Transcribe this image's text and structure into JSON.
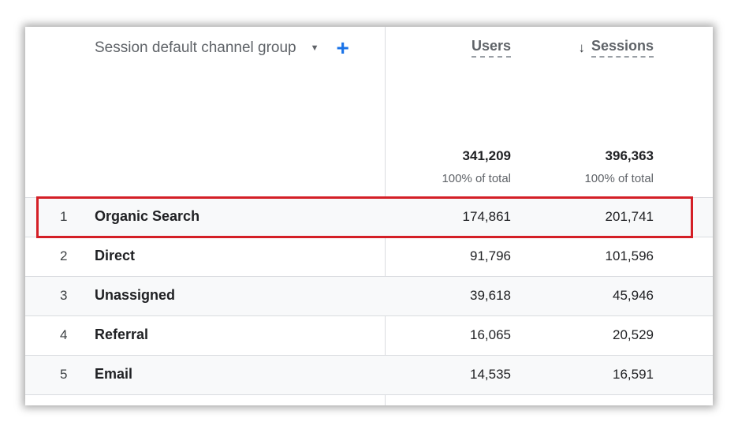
{
  "header": {
    "dimension_label": "Session default channel group",
    "dimension_dropdown_icon": "caret-down-icon",
    "add_dimension_icon": "plus-icon",
    "columns": [
      {
        "label": "Users",
        "sort_icon": ""
      },
      {
        "label": "Sessions",
        "sort_icon": "arrow-down-icon"
      }
    ]
  },
  "totals": {
    "users": {
      "value": "341,209",
      "pct": "100% of total"
    },
    "sessions": {
      "value": "396,363",
      "pct": "100% of total"
    }
  },
  "rows": [
    {
      "index": "1",
      "name": "Organic Search",
      "users": "174,861",
      "sessions": "201,741"
    },
    {
      "index": "2",
      "name": "Direct",
      "users": "91,796",
      "sessions": "101,596"
    },
    {
      "index": "3",
      "name": "Unassigned",
      "users": "39,618",
      "sessions": "45,946"
    },
    {
      "index": "4",
      "name": "Referral",
      "users": "16,065",
      "sessions": "20,529"
    },
    {
      "index": "5",
      "name": "Email",
      "users": "14,535",
      "sessions": "16,591"
    }
  ],
  "colors": {
    "highlight": "#d41f26",
    "accent": "#1a73e8",
    "row_alt": "#f8f9fa"
  }
}
